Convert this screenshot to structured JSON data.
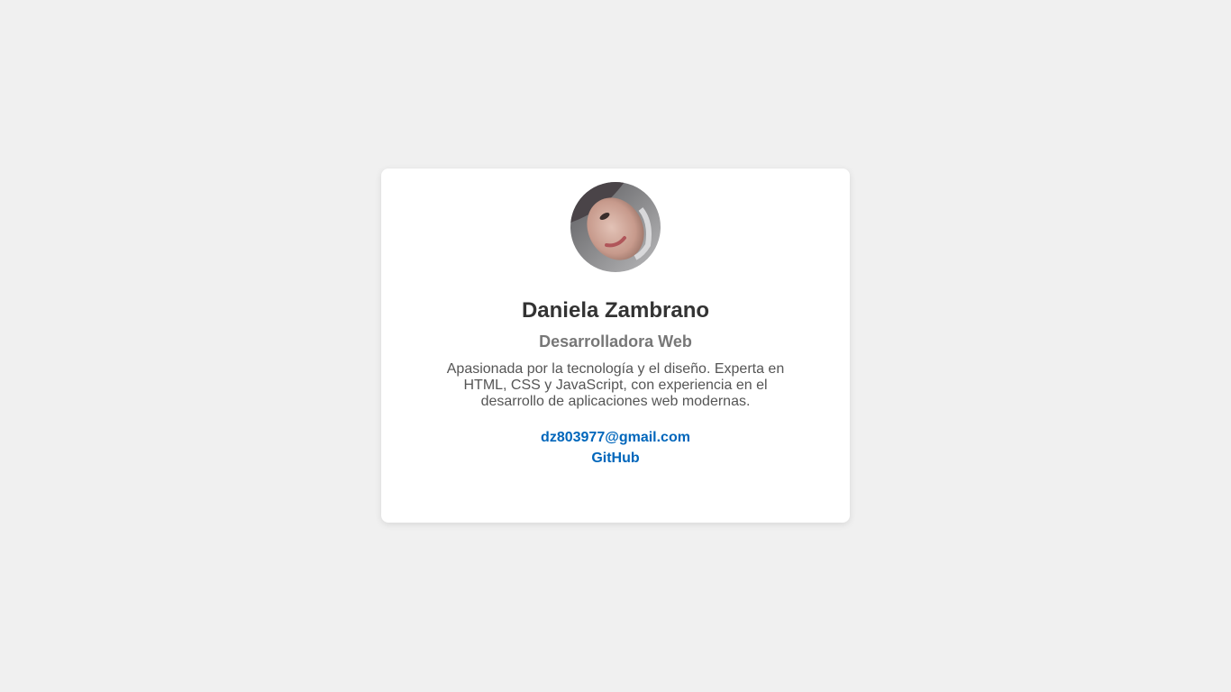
{
  "profile": {
    "avatar_alt": "Daniela Zambrano",
    "name": "Daniela Zambrano",
    "role": "Desarrolladora Web",
    "bio": "Apasionada por la tecnología y el diseño. Experta en HTML, CSS y JavaScript, con experiencia en el desarrollo de aplicaciones web modernas.",
    "email": "dz803977@gmail.com",
    "github": "GitHub"
  },
  "colors": {
    "page_background": "#f0f0f0",
    "card_background": "#ffffff",
    "name": "#333333",
    "role": "#777777",
    "bio": "#555555",
    "link": "#0066bb"
  }
}
